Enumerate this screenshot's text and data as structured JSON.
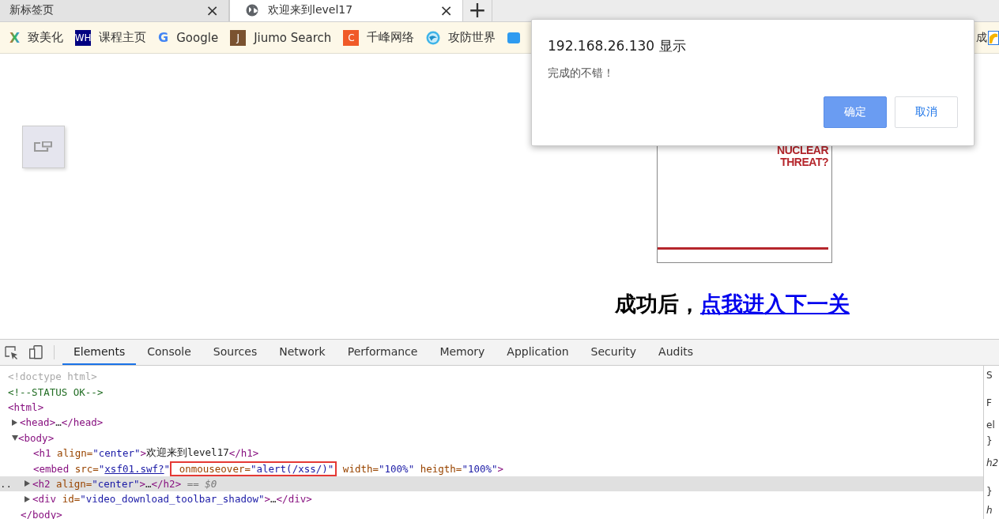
{
  "tabs": [
    {
      "title": "新标签页",
      "close": "×",
      "selected": false,
      "icon": false
    },
    {
      "title": "欢迎来到level17",
      "close": "×",
      "selected": true,
      "icon": true
    }
  ],
  "new_tab": "+",
  "bookmarks": [
    {
      "label": "致美化",
      "badge": "X",
      "kind": "x"
    },
    {
      "label": "课程主页",
      "badge": "WH",
      "kind": "square",
      "color": "#000080"
    },
    {
      "label": "Google",
      "badge": "G",
      "kind": "g"
    },
    {
      "label": "Jiumo Search",
      "badge": "J",
      "kind": "square",
      "color": "#7a5230"
    },
    {
      "label": "千峰网络",
      "badge": "C",
      "kind": "square",
      "color": "#f05a28"
    },
    {
      "label": "攻防世界",
      "kind": "globe"
    },
    {
      "kind": "blue"
    }
  ],
  "bookmark_fragment": "成",
  "dialog": {
    "title": "192.168.26.130 显示",
    "message": "完成的不错！",
    "buttons": [
      {
        "label": "确定",
        "primary": true
      },
      {
        "label": "取消",
        "primary": false
      }
    ]
  },
  "embed": {
    "lines": [
      "NUCLEAR",
      "THREAT?"
    ]
  },
  "heading": {
    "text": "成功后，",
    "link": "点我进入下一关"
  },
  "devtools": {
    "tabs": [
      {
        "label": "Elements",
        "selected": true
      },
      {
        "label": "Console",
        "selected": false
      },
      {
        "label": "Sources",
        "selected": false
      },
      {
        "label": "Network",
        "selected": false
      },
      {
        "label": "Performance",
        "selected": false
      },
      {
        "label": "Memory",
        "selected": false
      },
      {
        "label": "Application",
        "selected": false
      },
      {
        "label": "Security",
        "selected": false
      },
      {
        "label": "Audits",
        "selected": false
      }
    ],
    "tree": [
      {
        "tokens": [
          {
            "kind": "doctype",
            "text": "<!doctype html>"
          }
        ]
      },
      {
        "tokens": [
          {
            "kind": "comment",
            "text": "<!--STATUS OK-->"
          }
        ]
      },
      {
        "tokens": [
          {
            "kind": "tag",
            "text": "<html>"
          }
        ],
        "children": [
          {
            "expanded": false,
            "selected": false,
            "tokens": [
              {
                "kind": "tag",
                "text": "<head>"
              },
              {
                "kind": "text",
                "text": "…"
              },
              {
                "kind": "tag",
                "text": "</head>"
              }
            ]
          },
          {
            "expanded": true,
            "selected": false,
            "tokens": [
              {
                "kind": "tag",
                "text": "<body>"
              }
            ],
            "close": [
              {
                "kind": "tag",
                "text": "</body>"
              }
            ],
            "children": [
              {
                "selected": false,
                "tokens": [
                  {
                    "kind": "tag",
                    "text": "<h1"
                  },
                  {
                    "kind": "attr",
                    "text": " align="
                  },
                  {
                    "kind": "value",
                    "text": "\"center\""
                  },
                  {
                    "kind": "tag",
                    "text": ">"
                  },
                  {
                    "kind": "text",
                    "text": "欢迎来到level17"
                  },
                  {
                    "kind": "tag",
                    "text": "</h1>"
                  }
                ]
              },
              {
                "selected": false,
                "tokens": [
                  {
                    "kind": "tag",
                    "text": "<embed"
                  },
                  {
                    "kind": "attr",
                    "text": " src="
                  },
                  {
                    "kind": "value",
                    "text": "\""
                  },
                  {
                    "kind": "link",
                    "text": "xsf01.swf?"
                  },
                  {
                    "kind": "value",
                    "text": "\""
                  },
                  {
                    "kind": "boxed",
                    "tokens": [
                      {
                        "kind": "attr",
                        "text": " onmouseover="
                      },
                      {
                        "kind": "value",
                        "text": "\"alert(/xss/)\""
                      }
                    ]
                  },
                  {
                    "kind": "attr",
                    "text": " width="
                  },
                  {
                    "kind": "value",
                    "text": "\"100%\""
                  },
                  {
                    "kind": "attr",
                    "text": " heigth="
                  },
                  {
                    "kind": "value",
                    "text": "\"100%\""
                  },
                  {
                    "kind": "tag",
                    "text": ">"
                  }
                ]
              },
              {
                "expanded": false,
                "selected": true,
                "gutter": "..",
                "tokens": [
                  {
                    "kind": "tag",
                    "text": "<h2"
                  },
                  {
                    "kind": "attr",
                    "text": " align="
                  },
                  {
                    "kind": "value",
                    "text": "\"center\""
                  },
                  {
                    "kind": "tag",
                    "text": ">"
                  },
                  {
                    "kind": "text",
                    "text": "…"
                  },
                  {
                    "kind": "tag",
                    "text": "</h2>"
                  },
                  {
                    "kind": "marker",
                    "text": " == $0"
                  }
                ]
              },
              {
                "expanded": false,
                "selected": false,
                "tokens": [
                  {
                    "kind": "tag",
                    "text": "<div"
                  },
                  {
                    "kind": "attr",
                    "text": " id="
                  },
                  {
                    "kind": "value",
                    "text": "\"video_download_toolbar_shadow\""
                  },
                  {
                    "kind": "tag",
                    "text": ">"
                  },
                  {
                    "kind": "text",
                    "text": "…"
                  },
                  {
                    "kind": "tag",
                    "text": "</div>"
                  }
                ]
              }
            ]
          }
        ]
      }
    ],
    "side_fragments": [
      "S",
      "F",
      "el",
      "}",
      "h2",
      "}",
      "h"
    ]
  }
}
